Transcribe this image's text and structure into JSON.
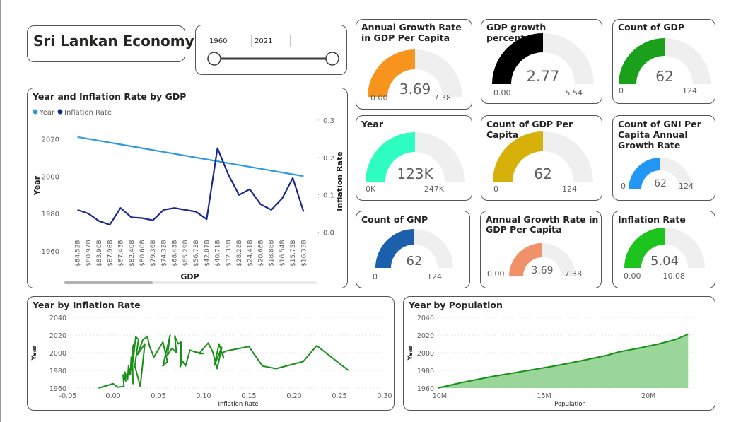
{
  "report": {
    "title": "Sri Lankan Economy"
  },
  "slicer": {
    "start": "1960",
    "end": "2021"
  },
  "gauges": [
    {
      "title": "Annual Growth Rate in GDP Per Capita",
      "value": 3.69,
      "value_label": "3.69",
      "min_label": "0.00",
      "max_label": "7.38",
      "fill": 0.5,
      "color": "#F7941D"
    },
    {
      "title": "GDP growth percentage",
      "value": 2.77,
      "value_label": "2.77",
      "min_label": "0.00",
      "max_label": "5.54",
      "fill": 0.5,
      "color": "#000000"
    },
    {
      "title": "Count of GDP",
      "value": 62,
      "value_label": "62",
      "min_label": "0",
      "max_label": "124",
      "fill": 0.5,
      "color": "#1AA01A"
    },
    {
      "title": "Year",
      "value": 123000,
      "value_label": "123K",
      "min_label": "0K",
      "max_label": "247K",
      "fill": 0.5,
      "color": "#2EFFC0"
    },
    {
      "title": "Count of GDP Per Capita",
      "value": 62,
      "value_label": "62",
      "min_label": "0",
      "max_label": "124",
      "fill": 0.5,
      "color": "#D6B10A"
    },
    {
      "title": "Count of GNI Per Capita Annual Growth Rate",
      "value": 62,
      "value_label": "62",
      "min_label": "0",
      "max_label": "124",
      "fill": 0.5,
      "color": "#2196F3"
    },
    {
      "title": "Count of GNP",
      "value": 62,
      "value_label": "62",
      "min_label": "0",
      "max_label": "124",
      "fill": 0.5,
      "color": "#1B5FAD"
    },
    {
      "title": "Annual Growth Rate in GDP Per Capita",
      "value": 3.69,
      "value_label": "3.69",
      "min_label": "0.00",
      "max_label": "7.38",
      "fill": 0.5,
      "color": "#F0916A"
    },
    {
      "title": "Inflation Rate",
      "value": 5.04,
      "value_label": "5.04",
      "min_label": "0.00",
      "max_label": "10.08",
      "fill": 0.5,
      "color": "#1DC41D"
    }
  ],
  "chart_data": [
    {
      "type": "line",
      "title": "Year and Inflation Rate by GDP",
      "xlabel": "GDP",
      "ylabel": "Year",
      "y2label": "Inflation Rate",
      "legend": [
        "Year",
        "Inflation Rate"
      ],
      "legend_position": "top-left",
      "categories": [
        "$84.52B",
        "$80.97B",
        "$83.90B",
        "$87.96B",
        "$87.43B",
        "$82.40B",
        "$80.60B",
        "$79.36B",
        "$74.32B",
        "$68.43B",
        "$65.29B",
        "$56.73B",
        "$42.07B",
        "$40.71B",
        "$32.35B",
        "$28.28B",
        "$24.41B",
        "$20.66B",
        "$18.88B",
        "$16.54B",
        "$15.75B",
        "$16.33B"
      ],
      "series": [
        {
          "name": "Year",
          "axis": "left",
          "color": "#2F9AE4",
          "values": [
            2021,
            2020,
            2019,
            2018,
            2017,
            2016,
            2015,
            2014,
            2013,
            2012,
            2011,
            2010,
            2009,
            2008,
            2007,
            2006,
            2005,
            2004,
            2003,
            2002,
            2001,
            2000
          ]
        },
        {
          "name": "Inflation Rate",
          "axis": "right",
          "color": "#1A2A8C",
          "values": [
            0.06,
            0.05,
            0.03,
            0.02,
            0.065,
            0.04,
            0.038,
            0.032,
            0.06,
            0.065,
            0.06,
            0.055,
            0.035,
            0.225,
            0.155,
            0.1,
            0.115,
            0.075,
            0.06,
            0.09,
            0.145,
            0.055
          ]
        }
      ],
      "ylim": [
        1960,
        2030
      ],
      "yticks": [
        1960,
        1980,
        2000,
        2020
      ],
      "y2lim": [
        -0.05,
        0.3
      ],
      "y2ticks": [
        "0.0",
        "0.1",
        "0.2",
        "0.3"
      ]
    },
    {
      "type": "line",
      "title": "Year by Inflation Rate",
      "xlabel": "Inflation Rate",
      "ylabel": "Year",
      "color": "#1A8F1A",
      "xlim": [
        -0.05,
        0.3
      ],
      "xticks": [
        "-0.05",
        "0.00",
        "0.05",
        "0.10",
        "0.15",
        "0.20",
        "0.25",
        "0.30"
      ],
      "ylim": [
        1960,
        2040
      ],
      "yticks": [
        1960,
        1980,
        2000,
        2020,
        2040
      ],
      "x": [
        -0.016,
        0.0,
        0.005,
        0.012,
        0.011,
        0.014,
        0.013,
        0.016,
        0.017,
        0.019,
        0.02,
        0.022,
        0.021,
        0.023,
        0.022,
        0.025,
        0.028,
        0.024,
        0.03,
        0.035,
        0.027,
        0.033,
        0.038,
        0.04,
        0.045,
        0.055,
        0.06,
        0.055,
        0.063,
        0.06,
        0.065,
        0.07,
        0.068,
        0.072,
        0.075,
        0.075,
        0.074,
        0.077,
        0.08,
        0.085,
        0.09,
        0.1,
        0.095,
        0.105,
        0.11,
        0.115,
        0.12,
        0.112,
        0.117,
        0.122,
        0.121,
        0.125,
        0.15,
        0.165,
        0.18,
        0.21,
        0.225,
        0.26
      ],
      "y": [
        1960,
        1965,
        1961,
        1962,
        1975,
        1968,
        1978,
        1970,
        1985,
        1975,
        1995,
        1965,
        2005,
        2010,
        1990,
        2018,
        2015,
        1985,
        1962,
        2010,
        1998,
        2015,
        2018,
        2008,
        1995,
        2012,
        1990,
        1985,
        2020,
        1997,
        2005,
        2000,
        2019,
        2010,
        2012,
        1990,
        1984,
        1990,
        1985,
        2003,
        2001,
        1999,
        1999,
        2011,
        2001,
        1982,
        2006,
        1986,
        2010,
        1994,
        2000,
        2002,
        2007,
        1985,
        1982,
        1990,
        2008,
        1980
      ]
    },
    {
      "type": "area",
      "title": "Year by Population",
      "xlabel": "Population",
      "ylabel": "Year",
      "color": "#1A8F1A",
      "xlim": [
        9.8,
        22.5
      ],
      "xticks": [
        "10M",
        "15M",
        "20M"
      ],
      "ylim": [
        1960,
        2040
      ],
      "yticks": [
        1960,
        1980,
        2000,
        2020,
        2040
      ],
      "x": [
        9.9,
        11.0,
        12.5,
        14.0,
        15.5,
        17.0,
        18.0,
        18.6,
        19.5,
        20.5,
        21.3,
        21.9
      ],
      "y": [
        1960,
        1966,
        1973,
        1979,
        1985,
        1992,
        1997,
        2001,
        2005,
        2010,
        2015,
        2021
      ]
    }
  ]
}
